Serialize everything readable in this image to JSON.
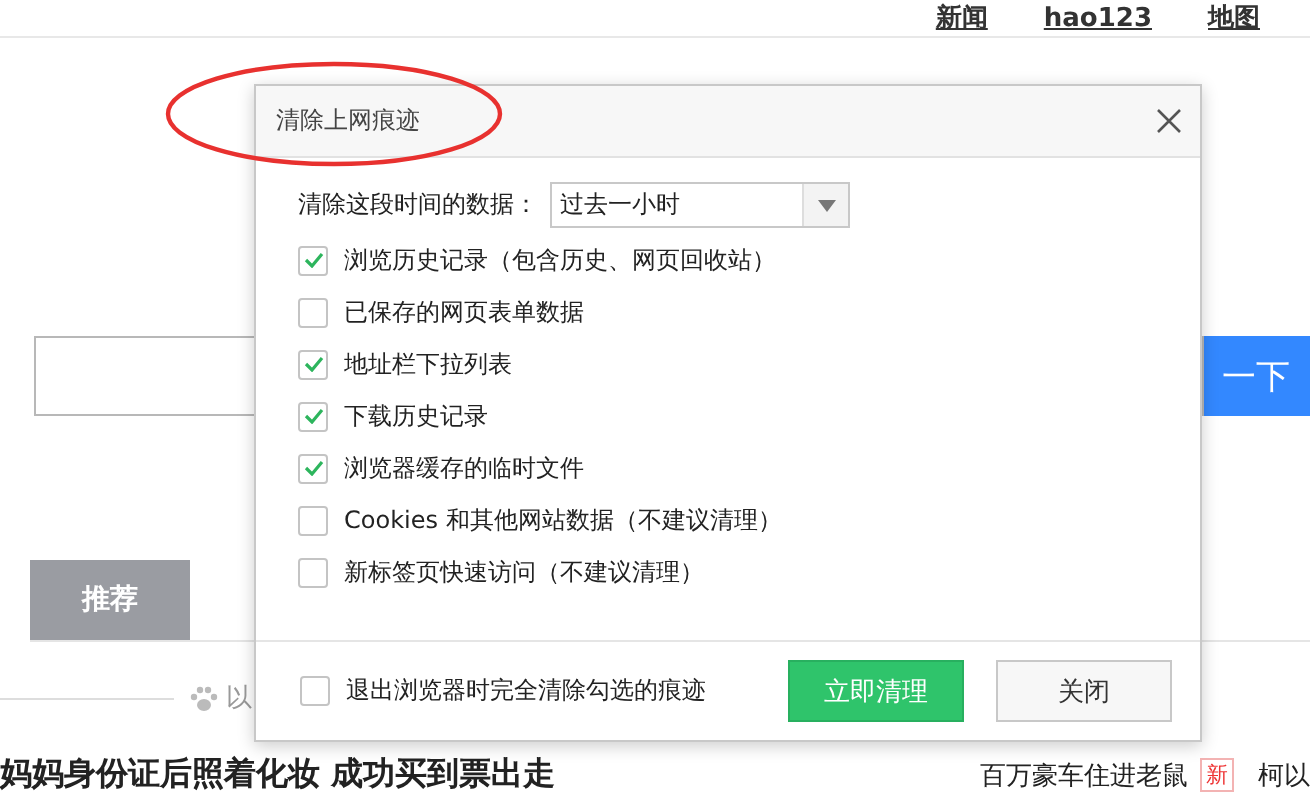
{
  "page": {
    "nav_links": [
      "新闻",
      "hao123",
      "地图"
    ],
    "search_button": "一下",
    "tabs": [
      {
        "label": "推荐",
        "selected": true
      }
    ],
    "feed_hint": "以",
    "headline": "妈妈身份证后照着化妆 成功买到票出走",
    "side_news": [
      {
        "title": "百万豪车住进老鼠",
        "badge": "新"
      },
      {
        "title": "柯以"
      }
    ]
  },
  "dialog": {
    "title": "清除上网痕迹",
    "range_label": "清除这段时间的数据：",
    "range_value": "过去一小时",
    "options": [
      {
        "label": "浏览历史记录（包含历史、网页回收站）",
        "checked": true
      },
      {
        "label": "已保存的网页表单数据",
        "checked": false
      },
      {
        "label": "地址栏下拉列表",
        "checked": true
      },
      {
        "label": "下载历史记录",
        "checked": true
      },
      {
        "label": "浏览器缓存的临时文件",
        "checked": true
      },
      {
        "label": "Cookies 和其他网站数据（不建议清理）",
        "checked": false
      },
      {
        "label": "新标签页快速访问（不建议清理）",
        "checked": false
      }
    ],
    "exit_option": {
      "label": "退出浏览器时完全清除勾选的痕迹",
      "checked": false
    },
    "buttons": [
      {
        "label": "立即清理",
        "kind": "primary"
      },
      {
        "label": "关闭",
        "kind": "secondary"
      }
    ]
  },
  "annotation": {
    "kind": "ellipse"
  }
}
